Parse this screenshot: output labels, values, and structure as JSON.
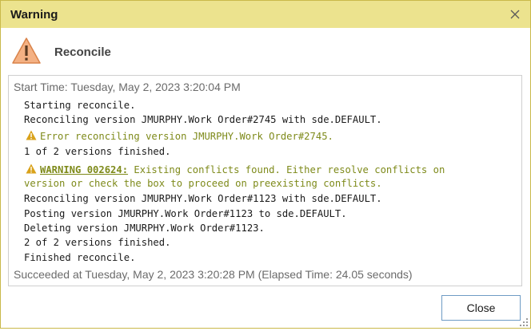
{
  "dialog": {
    "title": "Warning",
    "header": "Reconcile",
    "close_icon": "close-icon",
    "header_icon": "warning-triangle-icon",
    "accent_color": "#ece38e",
    "warning_color": "#7e8a1a"
  },
  "log": {
    "start_time": "Start Time: Tuesday, May 2, 2023 3:20:04 PM",
    "lines": [
      {
        "text": "Starting reconcile."
      },
      {
        "text": "Reconciling version JMURPHY.Work Order#2745 with sde.DEFAULT."
      },
      {
        "text": "Error reconciling version JMURPHY.Work Order#2745.",
        "level": "warning"
      },
      {
        "text": "1 of 2 versions finished."
      },
      {
        "code": "WARNING 002624:",
        "text": " Existing conflicts found. Either resolve conflicts on",
        "level": "warning"
      },
      {
        "text": "version or check the box to proceed on preexisting conflicts.",
        "level": "warning-continued"
      },
      {
        "text": "Reconciling version JMURPHY.Work Order#1123 with sde.DEFAULT."
      },
      {
        "text": "Posting version JMURPHY.Work Order#1123 to sde.DEFAULT."
      },
      {
        "text": "Deleting version JMURPHY.Work Order#1123."
      },
      {
        "text": "2 of 2 versions finished."
      },
      {
        "text": "Finished reconcile."
      }
    ],
    "end_time": "Succeeded at Tuesday, May 2, 2023 3:20:28 PM (Elapsed Time: 24.05 seconds)"
  },
  "buttons": {
    "close_label": "Close"
  }
}
